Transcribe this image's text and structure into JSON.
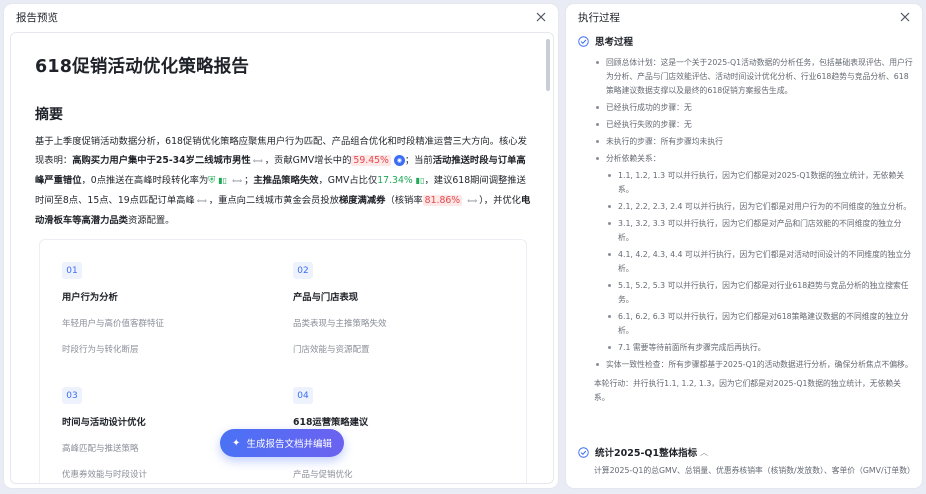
{
  "left_panel": {
    "title": "报告预览",
    "document": {
      "title": "618促销活动优化策略报告",
      "summary_heading": "摘要",
      "summary": {
        "p1": "基于上季度促销活动数据分析，618促销优化策略应聚焦用户行为匹配、产品组合优化和时段精准运营三大方向。核心发现表明：",
        "b1": "高购买力用户集中于25-34岁二线城市男性",
        "p2": "，贡献GMV增长中的",
        "pct1": "59.45%",
        "p3": "；当前",
        "b2": "活动推送时段与订单高峰严重错位",
        "p4": "，0点推送在高峰时段转化率为",
        "p5": "；",
        "b3": "主推品策略失效",
        "p6": "，GMV占比仅",
        "pct2": "17.34%",
        "p7": "，建议618期间调整推送时间至8点、15点、19点匹配订单高峰",
        "p8": "，重点向二线城市黄金会员投放",
        "b4": "梯度满减券",
        "p9": "（核销率",
        "pct3": "81.86%",
        "p10": "），并优化",
        "b5": "电动滑板车等高潜力品类",
        "p11": "资源配置。"
      },
      "toc": [
        {
          "num": "01",
          "title": "用户行为分析",
          "subs": [
            "年轻用户与高价值客群特征",
            "时段行为与转化断层"
          ]
        },
        {
          "num": "02",
          "title": "产品与门店表现",
          "subs": [
            "品类表现与主推策略失效",
            "门店效能与资源配置"
          ]
        },
        {
          "num": "03",
          "title": "时间与活动设计优化",
          "subs": [
            "高峰匹配与推送策略",
            "优惠券效能与时段设计"
          ]
        },
        {
          "num": "04",
          "title": "618运营策略建议",
          "subs": [
            "差异化营销",
            "产品与促销优化"
          ]
        }
      ]
    },
    "generate_button": "生成报告文档并编辑"
  },
  "right_panel": {
    "title": "执行过程",
    "thinking": {
      "heading": "思考过程",
      "bullets": [
        "回顾总体计划：这是一个关于2025-Q1活动数据的分析任务，包括基础表现评估、用户行为分析、产品与门店效能评估、活动时间设计优化分析、行业618趋势与竞品分析、618策略建议数据支撑以及最终的618促销方案报告生成。",
        "已经执行成功的步骤：无",
        "已经执行失败的步骤：无",
        "未执行的步骤：所有步骤均未执行",
        "分析依赖关系："
      ],
      "sub_bullets": [
        "1.1, 1.2, 1.3 可以并行执行，因为它们都是对2025-Q1数据的独立统计，无依赖关系。",
        "2.1, 2.2, 2.3, 2.4 可以并行执行，因为它们都是对用户行为的不同维度的独立分析。",
        "3.1, 3.2, 3.3 可以并行执行，因为它们都是对产品和门店效能的不同维度的独立分析。",
        "4.1, 4.2, 4.3, 4.4 可以并行执行，因为它们都是对活动时间设计的不同维度的独立分析。",
        "5.1, 5.2, 5.3 可以并行执行，因为它们都是对行业618趋势与竞品分析的独立搜索任务。",
        "6.1, 6.2, 6.3 可以并行执行，因为它们都是对618策略建议数据的不同维度的独立分析。",
        "7.1 需要等待前面所有步骤完成后再执行。"
      ],
      "extra_bullet": "实体一致性检查：所有步骤都基于2025-Q1的活动数据进行分析，确保分析焦点不偏移。",
      "conclusion": "本轮行动：并行执行1.1, 1.2, 1.3，因为它们都是对2025-Q1数据的独立统计，无依赖关系。"
    },
    "step2": {
      "heading": "统计2025-Q1整体指标",
      "desc": "计算2025-Q1的总GMV、总销量、优惠券核销率（核销数/发放数）、客单价（GMV/订单数）"
    }
  },
  "colors": {
    "accent": "#3b6ef5",
    "highlight_red": "#e5484d",
    "highlight_green": "#1fa855"
  },
  "icons": [
    "close-icon",
    "check-circle-icon",
    "sparkle-icon",
    "chevron-up-icon",
    "link-icon"
  ]
}
